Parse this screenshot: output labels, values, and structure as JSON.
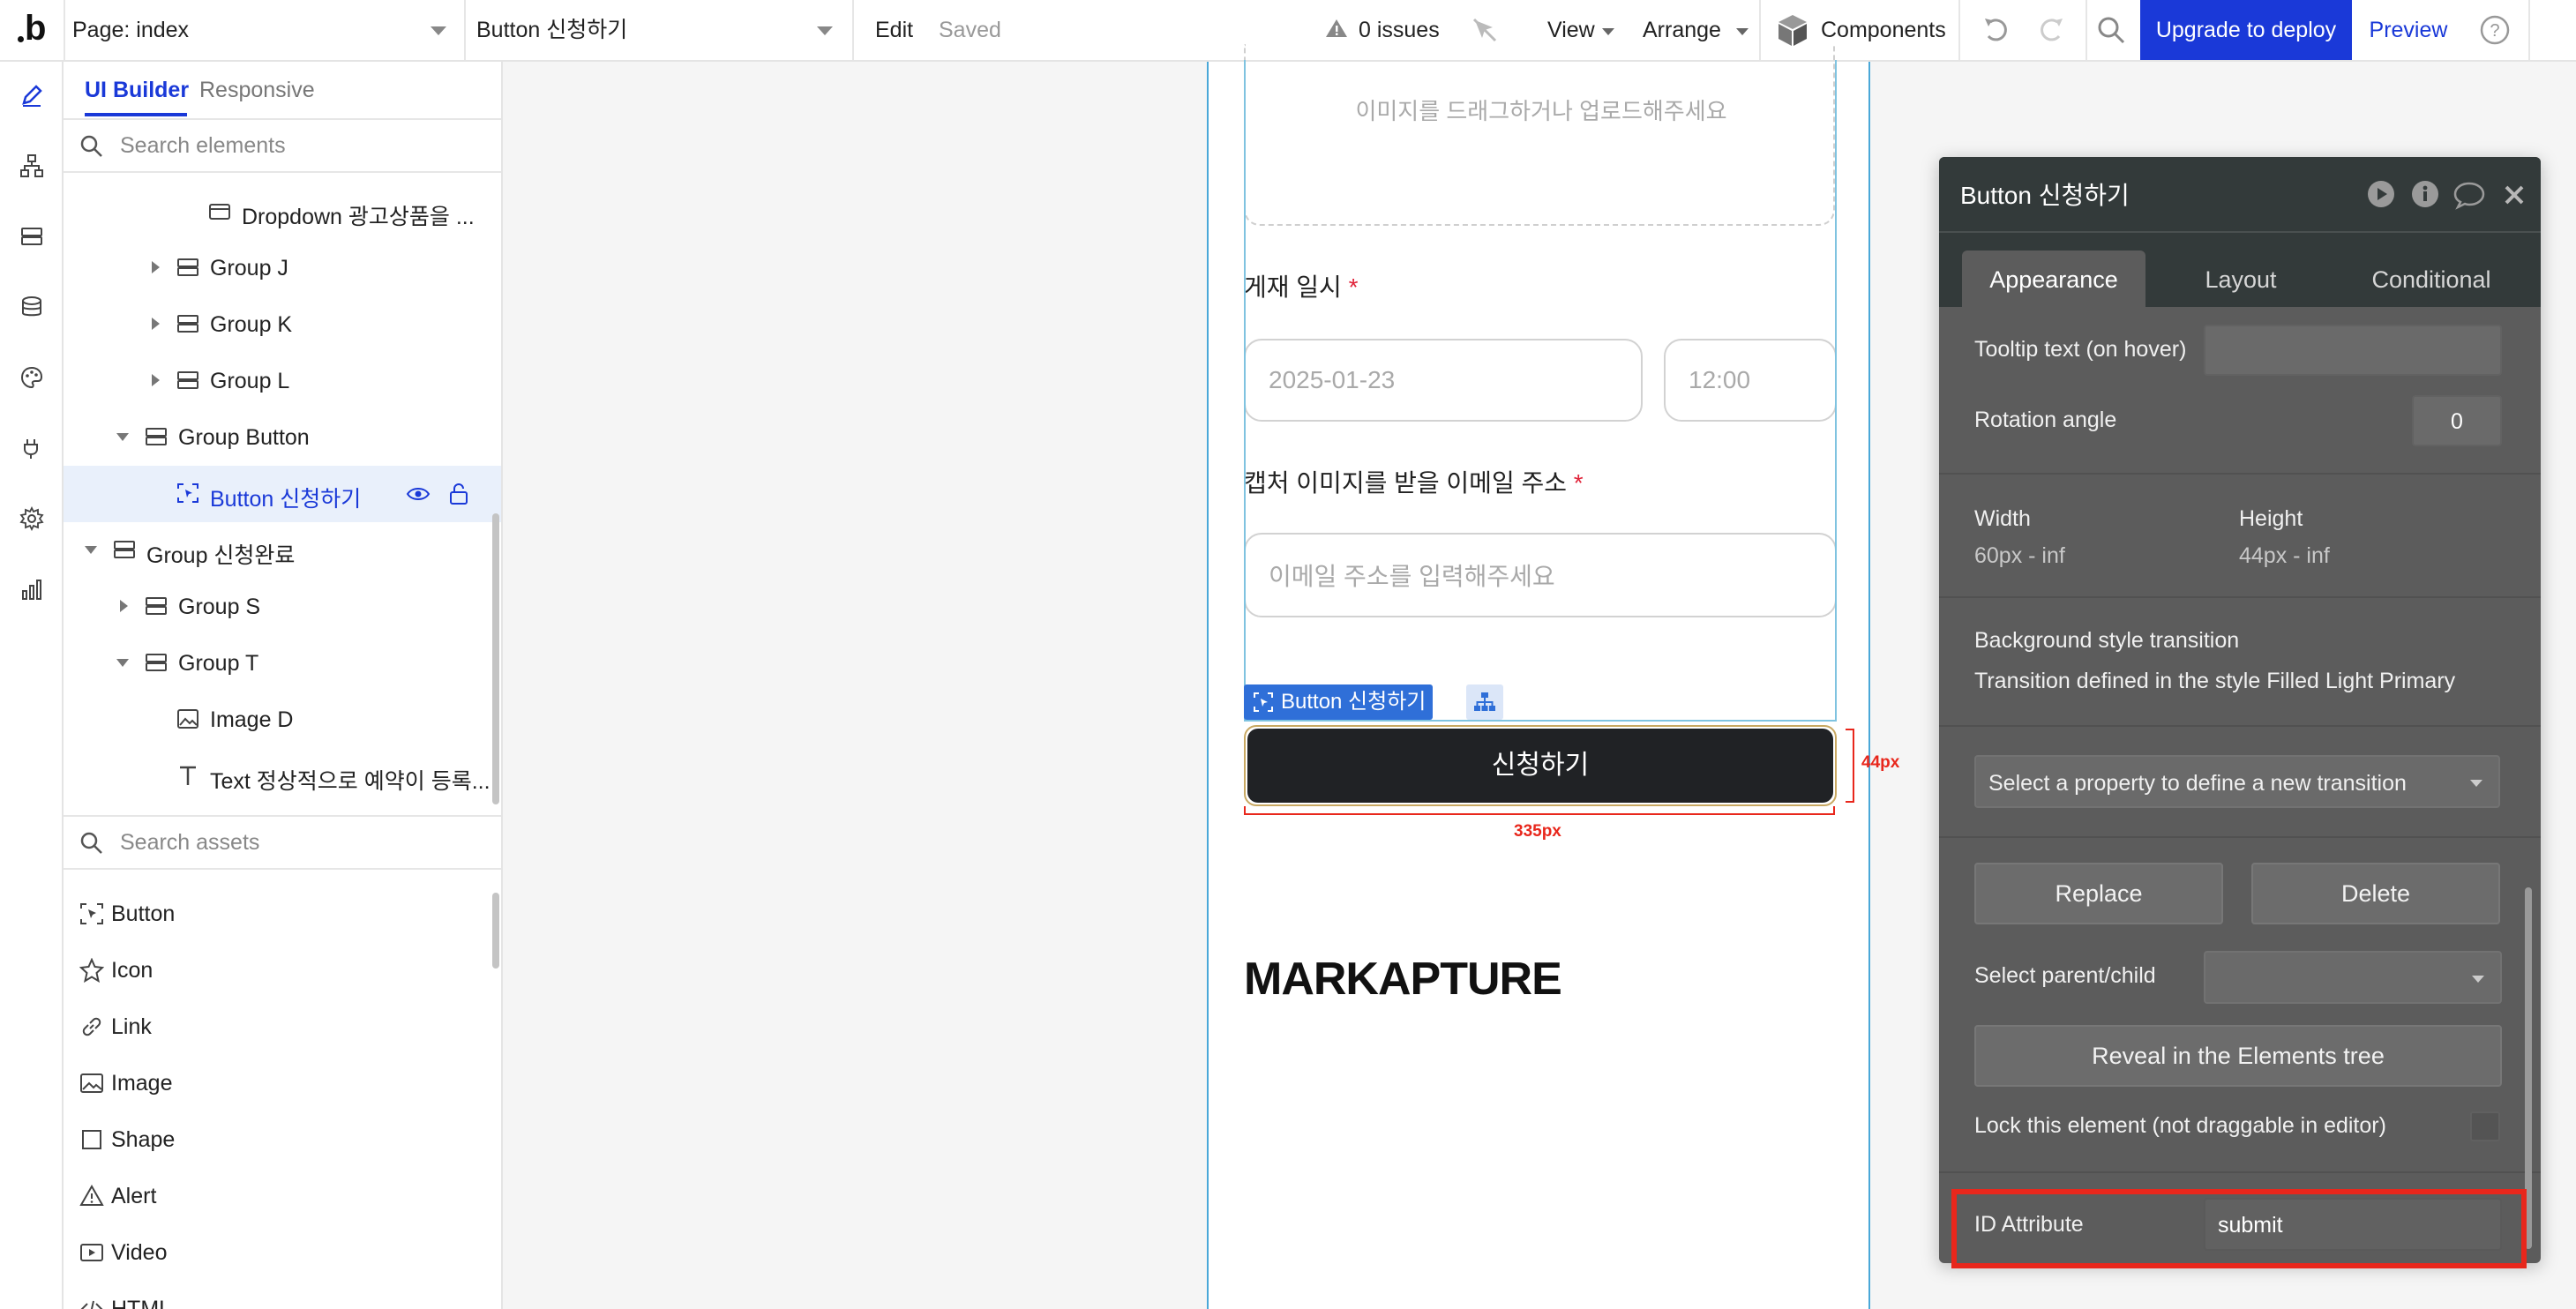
{
  "topbar": {
    "logo": "b",
    "page_select": "Page: index",
    "element_select": "Button 신청하기",
    "edit_label": "Edit",
    "saved_label": "Saved",
    "issues_label": "0 issues",
    "view_label": "View",
    "arrange_label": "Arrange",
    "components_label": "Components",
    "upgrade_label": "Upgrade to deploy",
    "preview_label": "Preview"
  },
  "sidebar": {
    "tab_ui": "UI Builder",
    "tab_responsive": "Responsive",
    "search_elements_placeholder": "Search elements",
    "tree": [
      {
        "label": "Dropdown 광고상품을 ...",
        "icon": "dropdown-icon"
      },
      {
        "label": "Group J",
        "icon": "group-icon"
      },
      {
        "label": "Group K",
        "icon": "group-icon"
      },
      {
        "label": "Group L",
        "icon": "group-icon"
      },
      {
        "label": "Group Button",
        "icon": "group-icon"
      },
      {
        "label": "Button 신청하기",
        "icon": "button-icon"
      },
      {
        "label": "Group 신청완료",
        "icon": "group-icon"
      },
      {
        "label": "Group S",
        "icon": "group-icon"
      },
      {
        "label": "Group T",
        "icon": "group-icon"
      },
      {
        "label": "Image D",
        "icon": "image-icon"
      },
      {
        "label": "Text 정상적으로 예약이 등록...",
        "icon": "text-icon"
      }
    ],
    "search_assets_placeholder": "Search assets",
    "assets": [
      {
        "label": "Button",
        "icon": "button-icon"
      },
      {
        "label": "Icon",
        "icon": "star-icon"
      },
      {
        "label": "Link",
        "icon": "link-icon"
      },
      {
        "label": "Image",
        "icon": "image-icon"
      },
      {
        "label": "Shape",
        "icon": "shape-icon"
      },
      {
        "label": "Alert",
        "icon": "alert-icon"
      },
      {
        "label": "Video",
        "icon": "video-icon"
      },
      {
        "label": "HTML",
        "icon": "html-icon"
      }
    ]
  },
  "canvas": {
    "upload_placeholder": "이미지를 드래그하거나 업로드해주세요",
    "date_label": "게재 일시",
    "required_mark": "*",
    "date_placeholder": "2025-01-23",
    "time_placeholder": "12:00",
    "email_label": "캡처 이미지를 받을 이메일 주소",
    "email_placeholder": "이메일 주소를 입력해주세요",
    "selected_tag": "Button 신청하기",
    "submit_button": "신청하기",
    "height_dim": "44px",
    "width_dim": "335px",
    "brand": "MARKAPTURE"
  },
  "editor": {
    "title": "Button 신청하기",
    "tabs": [
      "Appearance",
      "Layout",
      "Conditional"
    ],
    "tooltip_label": "Tooltip text (on hover)",
    "tooltip_value": "",
    "rotation_label": "Rotation angle",
    "rotation_value": "0",
    "width_label": "Width",
    "width_value": "60px - inf",
    "height_label": "Height",
    "height_value": "44px - inf",
    "bg_transition_label": "Background style transition",
    "bg_transition_value": "Transition defined in the style Filled Light Primary",
    "transition_select": "Select a property to define a new transition",
    "replace_label": "Replace",
    "delete_label": "Delete",
    "parent_child_label": "Select parent/child",
    "reveal_label": "Reveal in the Elements tree",
    "lock_label": "Lock this element (not draggable in editor)",
    "id_attr_label": "ID Attribute",
    "id_attr_value": "submit"
  },
  "colors": {
    "accent": "#1a39d8",
    "highlight": "#e8271c",
    "editor_bg": "#5c5c5c",
    "editor_header": "#333a3a",
    "button_dark": "#202225"
  }
}
